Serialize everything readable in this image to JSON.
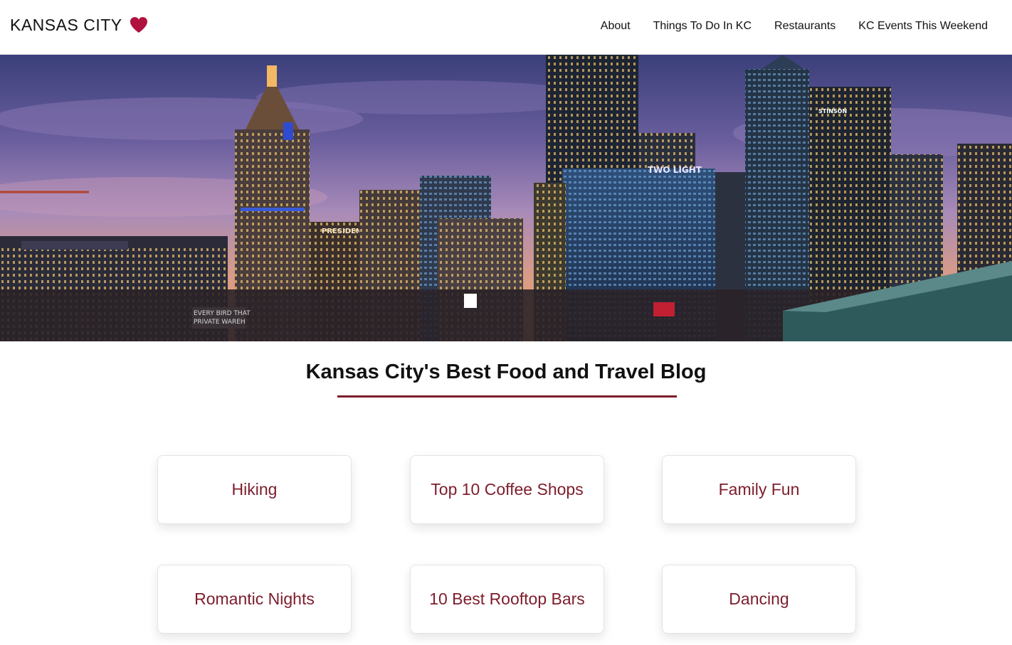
{
  "brand": {
    "name": "KANSAS CITY",
    "heart_color": "#b0123f",
    "icon": "heart-icon"
  },
  "nav": [
    {
      "label": "About"
    },
    {
      "label": "Things To Do In KC"
    },
    {
      "label": "Restaurants"
    },
    {
      "label": "KC Events This Weekend"
    }
  ],
  "hero": {
    "signs": {
      "two_light": "TWO LIGHT",
      "president": "PRESIDENT",
      "stinson": "STINSON",
      "mural_line1": "EVERY BIRD THAT",
      "mural_line2": "PRIVATE WAREH"
    }
  },
  "main": {
    "title": "Kansas City's Best Food and Travel Blog",
    "accent_color": "#7d1d2b"
  },
  "cards": [
    {
      "label": "Hiking"
    },
    {
      "label": "Top 10 Coffee Shops"
    },
    {
      "label": "Family Fun"
    },
    {
      "label": "Romantic Nights"
    },
    {
      "label": "10 Best Rooftop Bars"
    },
    {
      "label": "Dancing"
    }
  ]
}
